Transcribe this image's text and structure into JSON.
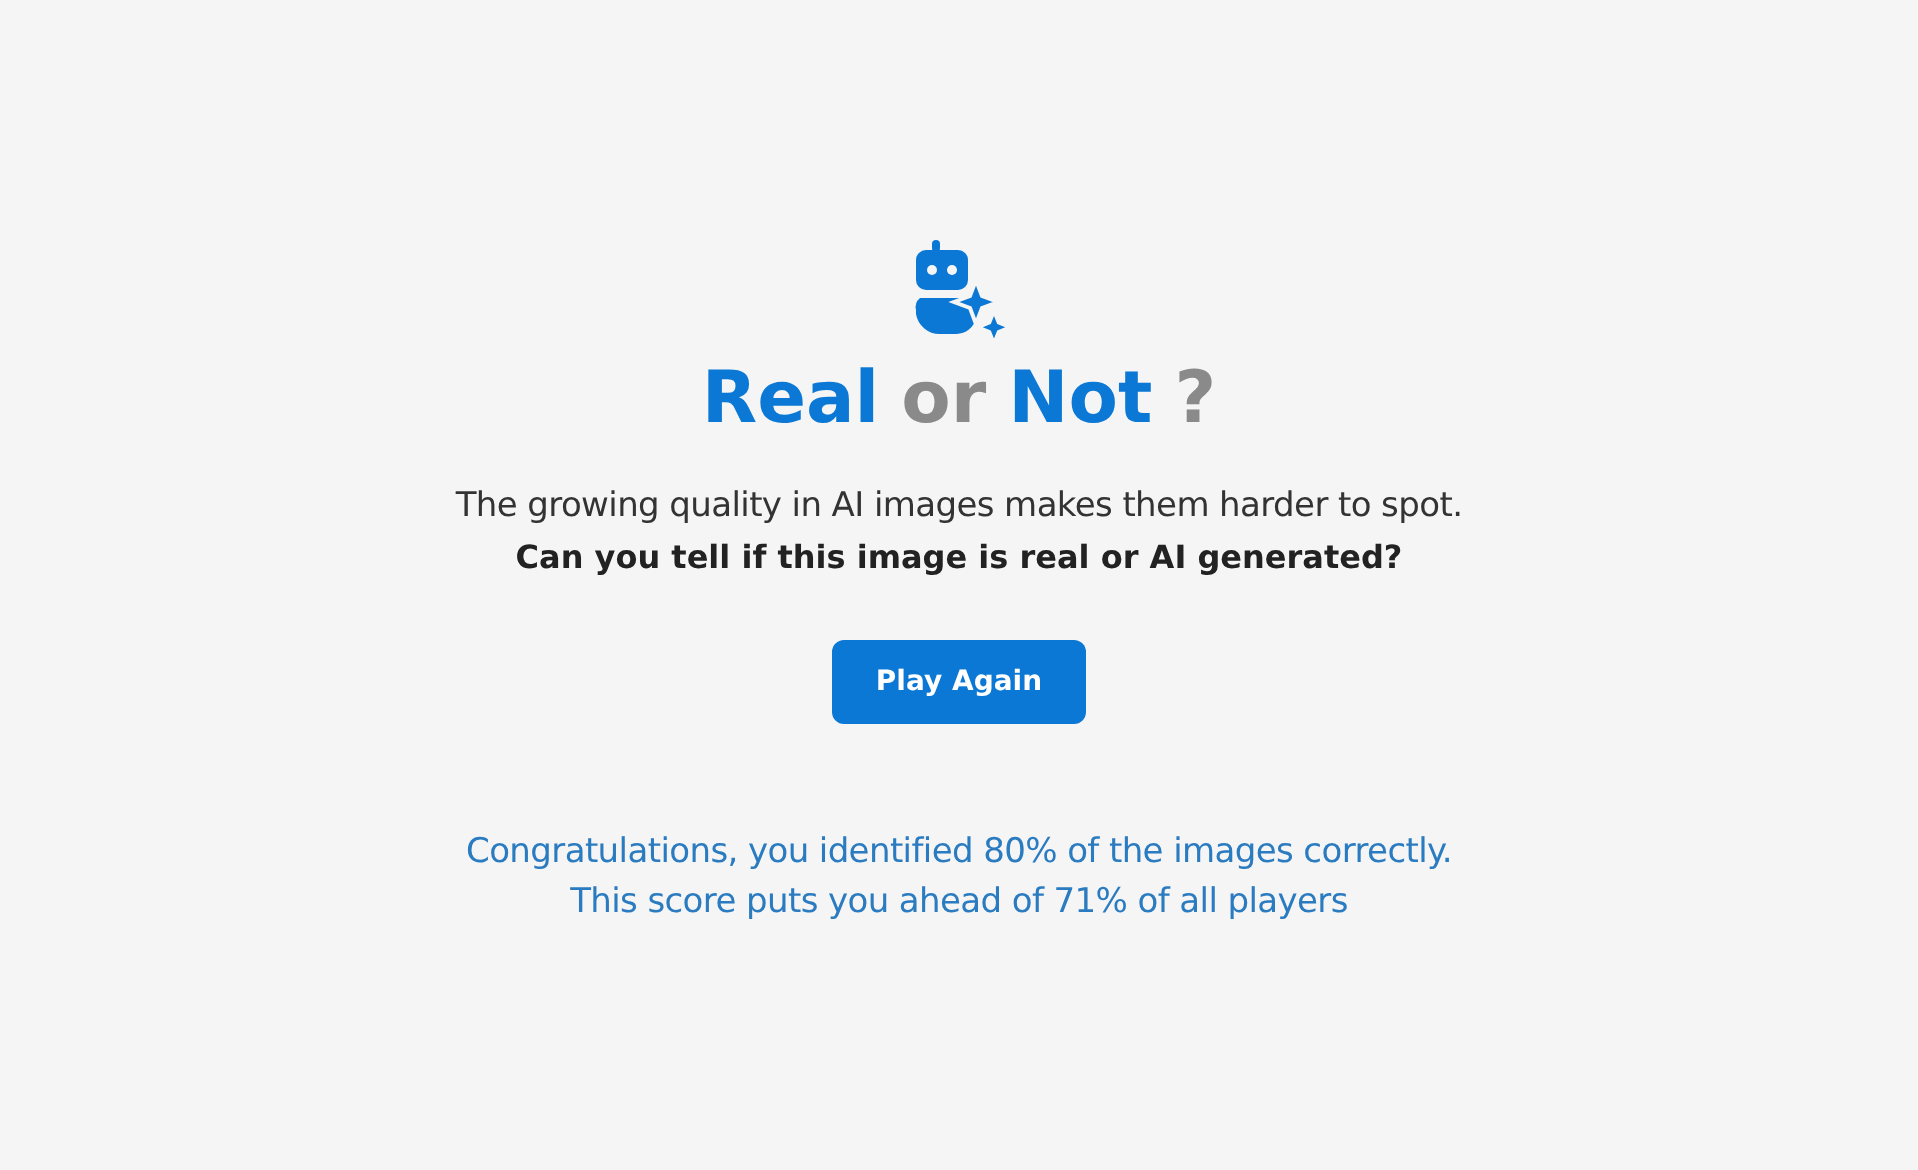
{
  "title": [
    {
      "text": "Real",
      "color": "#0a78d4"
    },
    {
      "text": "or",
      "color": "#8a8a8a"
    },
    {
      "text": "Not",
      "color": "#0a78d4"
    },
    {
      "text": "?",
      "color": "#8a8a8a"
    }
  ],
  "description": "The growing quality in AI images makes them harder to spot.",
  "question": "Can you tell if this image is real or AI generated?",
  "button": "Play Again",
  "result": [
    "Congratulations, you identified 80% of the images correctly.",
    "This score puts you ahead of 71% of all players"
  ]
}
